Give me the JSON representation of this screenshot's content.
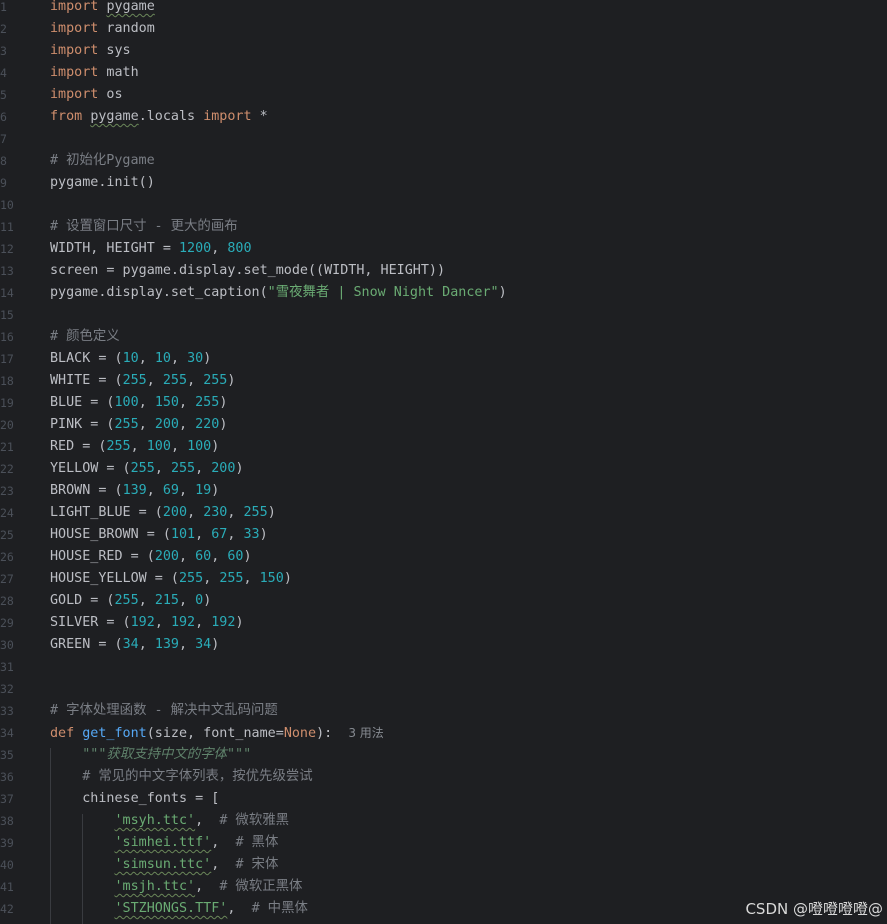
{
  "editor": {
    "lines": [
      {
        "n": "1",
        "seg": [
          {
            "t": "import",
            "c": "kw"
          },
          {
            "t": " "
          },
          {
            "t": "pygame",
            "c": "wavy"
          }
        ]
      },
      {
        "n": "2",
        "seg": [
          {
            "t": "import",
            "c": "kw"
          },
          {
            "t": " random"
          }
        ]
      },
      {
        "n": "3",
        "seg": [
          {
            "t": "import",
            "c": "kw"
          },
          {
            "t": " sys"
          }
        ]
      },
      {
        "n": "4",
        "seg": [
          {
            "t": "import",
            "c": "kw"
          },
          {
            "t": " math"
          }
        ]
      },
      {
        "n": "5",
        "seg": [
          {
            "t": "import",
            "c": "kw"
          },
          {
            "t": " os"
          }
        ]
      },
      {
        "n": "6",
        "seg": [
          {
            "t": "from",
            "c": "kw"
          },
          {
            "t": " "
          },
          {
            "t": "pygame",
            "c": "wavy"
          },
          {
            "t": ".locals "
          },
          {
            "t": "import",
            "c": "kw"
          },
          {
            "t": " *"
          }
        ]
      },
      {
        "n": "7",
        "seg": []
      },
      {
        "n": "8",
        "seg": [
          {
            "t": "# 初始化Pygame",
            "c": "cm"
          }
        ]
      },
      {
        "n": "9",
        "seg": [
          {
            "t": "pygame.init()"
          }
        ]
      },
      {
        "n": "10",
        "seg": []
      },
      {
        "n": "11",
        "seg": [
          {
            "t": "# 设置窗口尺寸 - 更大的画布",
            "c": "cm"
          }
        ]
      },
      {
        "n": "12",
        "seg": [
          {
            "t": "WIDTH, HEIGHT = "
          },
          {
            "t": "1200",
            "c": "num"
          },
          {
            "t": ", "
          },
          {
            "t": "800",
            "c": "num"
          }
        ]
      },
      {
        "n": "13",
        "seg": [
          {
            "t": "screen = pygame.display.set_mode((WIDTH, HEIGHT))"
          }
        ]
      },
      {
        "n": "14",
        "seg": [
          {
            "t": "pygame.display.set_caption("
          },
          {
            "t": "\"雪夜舞者 | Snow Night Dancer\"",
            "c": "str"
          },
          {
            "t": ")"
          }
        ]
      },
      {
        "n": "15",
        "seg": []
      },
      {
        "n": "16",
        "seg": [
          {
            "t": "# 颜色定义",
            "c": "cm"
          }
        ]
      },
      {
        "n": "17",
        "seg": [
          {
            "t": "BLACK = ("
          },
          {
            "t": "10",
            "c": "num"
          },
          {
            "t": ", "
          },
          {
            "t": "10",
            "c": "num"
          },
          {
            "t": ", "
          },
          {
            "t": "30",
            "c": "num"
          },
          {
            "t": ")"
          }
        ]
      },
      {
        "n": "18",
        "seg": [
          {
            "t": "WHITE = ("
          },
          {
            "t": "255",
            "c": "num"
          },
          {
            "t": ", "
          },
          {
            "t": "255",
            "c": "num"
          },
          {
            "t": ", "
          },
          {
            "t": "255",
            "c": "num"
          },
          {
            "t": ")"
          }
        ]
      },
      {
        "n": "19",
        "seg": [
          {
            "t": "BLUE = ("
          },
          {
            "t": "100",
            "c": "num"
          },
          {
            "t": ", "
          },
          {
            "t": "150",
            "c": "num"
          },
          {
            "t": ", "
          },
          {
            "t": "255",
            "c": "num"
          },
          {
            "t": ")"
          }
        ]
      },
      {
        "n": "20",
        "seg": [
          {
            "t": "PINK = ("
          },
          {
            "t": "255",
            "c": "num"
          },
          {
            "t": ", "
          },
          {
            "t": "200",
            "c": "num"
          },
          {
            "t": ", "
          },
          {
            "t": "220",
            "c": "num"
          },
          {
            "t": ")"
          }
        ]
      },
      {
        "n": "21",
        "seg": [
          {
            "t": "RED = ("
          },
          {
            "t": "255",
            "c": "num"
          },
          {
            "t": ", "
          },
          {
            "t": "100",
            "c": "num"
          },
          {
            "t": ", "
          },
          {
            "t": "100",
            "c": "num"
          },
          {
            "t": ")"
          }
        ]
      },
      {
        "n": "22",
        "seg": [
          {
            "t": "YELLOW = ("
          },
          {
            "t": "255",
            "c": "num"
          },
          {
            "t": ", "
          },
          {
            "t": "255",
            "c": "num"
          },
          {
            "t": ", "
          },
          {
            "t": "200",
            "c": "num"
          },
          {
            "t": ")"
          }
        ]
      },
      {
        "n": "23",
        "seg": [
          {
            "t": "BROWN = ("
          },
          {
            "t": "139",
            "c": "num"
          },
          {
            "t": ", "
          },
          {
            "t": "69",
            "c": "num"
          },
          {
            "t": ", "
          },
          {
            "t": "19",
            "c": "num"
          },
          {
            "t": ")"
          }
        ]
      },
      {
        "n": "24",
        "seg": [
          {
            "t": "LIGHT_BLUE = ("
          },
          {
            "t": "200",
            "c": "num"
          },
          {
            "t": ", "
          },
          {
            "t": "230",
            "c": "num"
          },
          {
            "t": ", "
          },
          {
            "t": "255",
            "c": "num"
          },
          {
            "t": ")"
          }
        ]
      },
      {
        "n": "25",
        "seg": [
          {
            "t": "HOUSE_BROWN = ("
          },
          {
            "t": "101",
            "c": "num"
          },
          {
            "t": ", "
          },
          {
            "t": "67",
            "c": "num"
          },
          {
            "t": ", "
          },
          {
            "t": "33",
            "c": "num"
          },
          {
            "t": ")"
          }
        ]
      },
      {
        "n": "26",
        "seg": [
          {
            "t": "HOUSE_RED = ("
          },
          {
            "t": "200",
            "c": "num"
          },
          {
            "t": ", "
          },
          {
            "t": "60",
            "c": "num"
          },
          {
            "t": ", "
          },
          {
            "t": "60",
            "c": "num"
          },
          {
            "t": ")"
          }
        ]
      },
      {
        "n": "27",
        "seg": [
          {
            "t": "HOUSE_YELLOW = ("
          },
          {
            "t": "255",
            "c": "num"
          },
          {
            "t": ", "
          },
          {
            "t": "255",
            "c": "num"
          },
          {
            "t": ", "
          },
          {
            "t": "150",
            "c": "num"
          },
          {
            "t": ")"
          }
        ]
      },
      {
        "n": "28",
        "seg": [
          {
            "t": "GOLD = ("
          },
          {
            "t": "255",
            "c": "num"
          },
          {
            "t": ", "
          },
          {
            "t": "215",
            "c": "num"
          },
          {
            "t": ", "
          },
          {
            "t": "0",
            "c": "num"
          },
          {
            "t": ")"
          }
        ]
      },
      {
        "n": "29",
        "seg": [
          {
            "t": "SILVER = ("
          },
          {
            "t": "192",
            "c": "num"
          },
          {
            "t": ", "
          },
          {
            "t": "192",
            "c": "num"
          },
          {
            "t": ", "
          },
          {
            "t": "192",
            "c": "num"
          },
          {
            "t": ")"
          }
        ]
      },
      {
        "n": "30",
        "seg": [
          {
            "t": "GREEN = ("
          },
          {
            "t": "34",
            "c": "num"
          },
          {
            "t": ", "
          },
          {
            "t": "139",
            "c": "num"
          },
          {
            "t": ", "
          },
          {
            "t": "34",
            "c": "num"
          },
          {
            "t": ")"
          }
        ]
      },
      {
        "n": "31",
        "seg": []
      },
      {
        "n": "32",
        "seg": []
      },
      {
        "n": "33",
        "seg": [
          {
            "t": "# 字体处理函数 - 解决中文乱码问题",
            "c": "cm"
          }
        ]
      },
      {
        "n": "34",
        "seg": [
          {
            "t": "def",
            "c": "kw"
          },
          {
            "t": " "
          },
          {
            "t": "get_font",
            "c": "fn"
          },
          {
            "t": "(size, font_name="
          },
          {
            "t": "None",
            "c": "kw"
          },
          {
            "t": "):  "
          },
          {
            "t": "3 用法",
            "c": "hint"
          }
        ]
      },
      {
        "n": "35",
        "seg": [
          {
            "t": "    "
          },
          {
            "t": "\"\"\"获取支持中文的字体\"\"\"",
            "c": "doc"
          }
        ]
      },
      {
        "n": "36",
        "seg": [
          {
            "t": "    "
          },
          {
            "t": "# 常见的中文字体列表，按优先级尝试",
            "c": "cm"
          }
        ]
      },
      {
        "n": "37",
        "seg": [
          {
            "t": "    chinese_fonts = ["
          }
        ]
      },
      {
        "n": "38",
        "seg": [
          {
            "t": "        "
          },
          {
            "t": "'msyh.ttc'",
            "c": "str wavy"
          },
          {
            "t": ",  "
          },
          {
            "t": "# 微软雅黑",
            "c": "cm"
          }
        ]
      },
      {
        "n": "39",
        "seg": [
          {
            "t": "        "
          },
          {
            "t": "'simhei.ttf'",
            "c": "str wavy"
          },
          {
            "t": ",  "
          },
          {
            "t": "# 黑体",
            "c": "cm"
          }
        ]
      },
      {
        "n": "40",
        "seg": [
          {
            "t": "        "
          },
          {
            "t": "'simsun.ttc'",
            "c": "str wavy"
          },
          {
            "t": ",  "
          },
          {
            "t": "# 宋体",
            "c": "cm"
          }
        ]
      },
      {
        "n": "41",
        "seg": [
          {
            "t": "        "
          },
          {
            "t": "'msjh.ttc'",
            "c": "str wavy"
          },
          {
            "t": ",  "
          },
          {
            "t": "# 微软正黑体",
            "c": "cm"
          }
        ]
      },
      {
        "n": "42",
        "seg": [
          {
            "t": "        "
          },
          {
            "t": "'STZHONGS.TTF'",
            "c": "str wavy"
          },
          {
            "t": ",  "
          },
          {
            "t": "# 中黑体",
            "c": "cm"
          }
        ]
      }
    ]
  },
  "watermark": "CSDN @噔噔噔噔@"
}
